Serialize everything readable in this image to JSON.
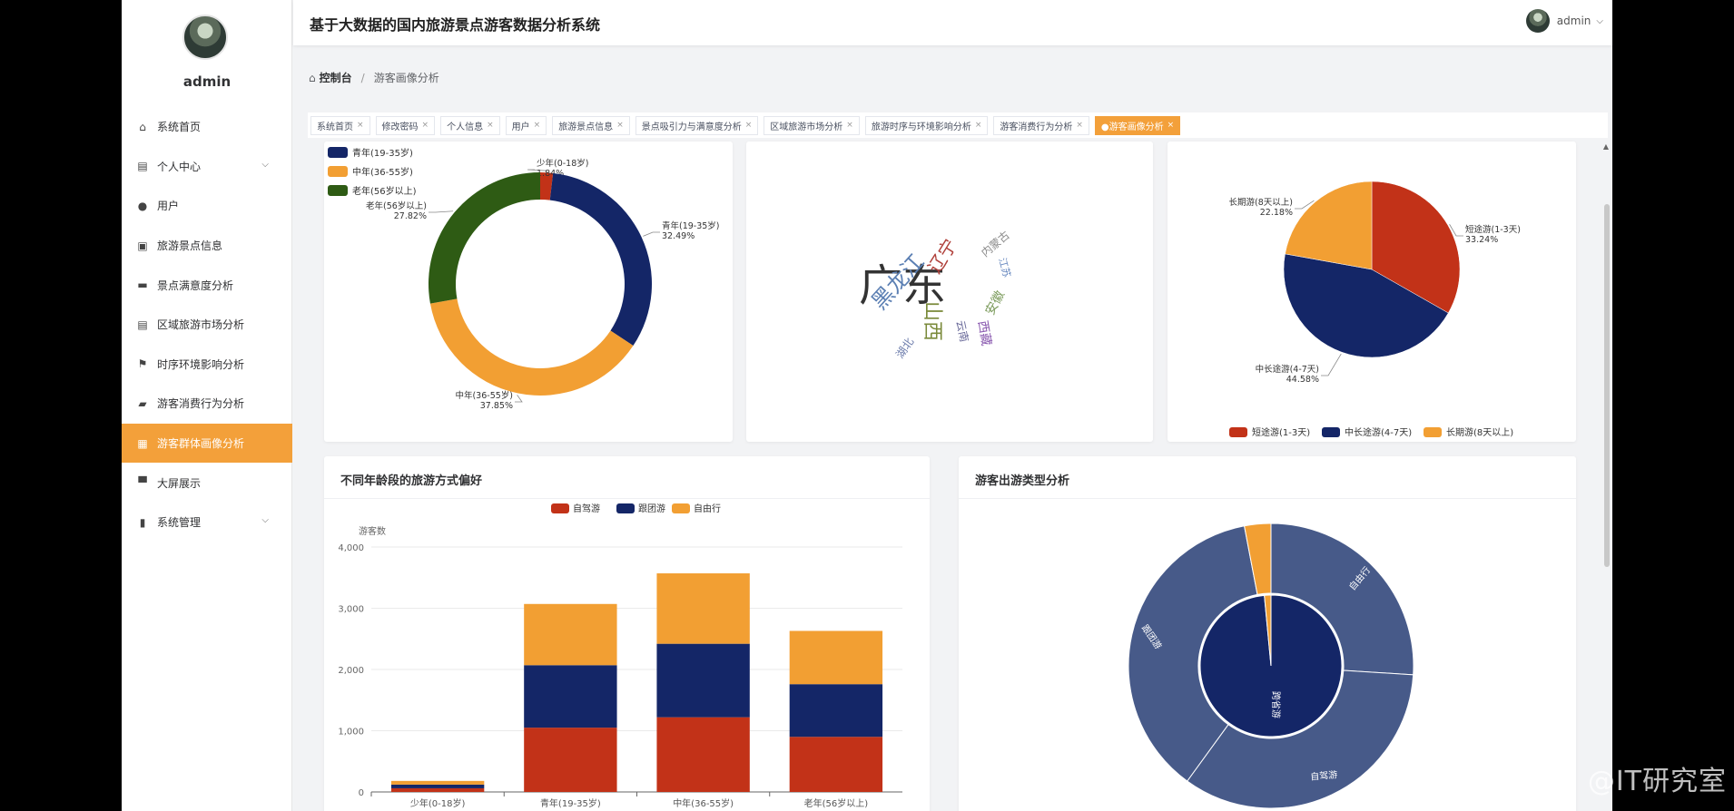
{
  "app": {
    "title": "基于大数据的国内旅游景点游客数据分析系统",
    "user": "admin"
  },
  "sidebar": {
    "username": "admin",
    "items": [
      {
        "label": "系统首页",
        "icon": "home-icon",
        "glyph": "⌂",
        "chevron": false,
        "active": false
      },
      {
        "label": "个人中心",
        "icon": "id-card-icon",
        "glyph": "▤",
        "chevron": true,
        "active": false
      },
      {
        "label": "用户",
        "icon": "location-pin-icon",
        "glyph": "●",
        "chevron": false,
        "active": false
      },
      {
        "label": "旅游景点信息",
        "icon": "clipboard-x-icon",
        "glyph": "▣",
        "chevron": false,
        "active": false
      },
      {
        "label": "景点满意度分析",
        "icon": "briefcase-icon",
        "glyph": "▬",
        "chevron": false,
        "active": false
      },
      {
        "label": "区域旅游市场分析",
        "icon": "clipboard-icon",
        "glyph": "▤",
        "chevron": false,
        "active": false
      },
      {
        "label": "时序环境影响分析",
        "icon": "flag-icon",
        "glyph": "⚑",
        "chevron": false,
        "active": false
      },
      {
        "label": "游客消费行为分析",
        "icon": "ticket-icon",
        "glyph": "▰",
        "chevron": false,
        "active": false
      },
      {
        "label": "游客群体画像分析",
        "icon": "grid-icon",
        "glyph": "▦",
        "chevron": false,
        "active": true
      },
      {
        "label": "大屏展示",
        "icon": "monitor-icon",
        "glyph": "▀",
        "chevron": false,
        "active": false
      },
      {
        "label": "系统管理",
        "icon": "bar-chart-icon",
        "glyph": "▮",
        "chevron": true,
        "active": false
      }
    ]
  },
  "breadcrumb": {
    "home": "控制台",
    "current": "游客画像分析"
  },
  "tags": [
    {
      "label": "系统首页",
      "active": false
    },
    {
      "label": "修改密码",
      "active": false
    },
    {
      "label": "个人信息",
      "active": false
    },
    {
      "label": "用户",
      "active": false
    },
    {
      "label": "旅游景点信息",
      "active": false
    },
    {
      "label": "景点吸引力与满意度分析",
      "active": false
    },
    {
      "label": "区域旅游市场分析",
      "active": false
    },
    {
      "label": "旅游时序与环境影响分析",
      "active": false
    },
    {
      "label": "游客消费行为分析",
      "active": false
    },
    {
      "label": "●游客画像分析",
      "active": true
    }
  ],
  "colors": {
    "accent": "#f3a03a",
    "red": "#c23218",
    "navy": "#142667",
    "orange": "#f29f33",
    "green": "#2e5b14",
    "slate": "#475a89"
  },
  "chart_data": [
    {
      "type": "pie",
      "variant": "donut",
      "slices": [
        {
          "name": "少年(0-18岁)",
          "value": 1.84,
          "label": "1.84%",
          "color": "#c23218"
        },
        {
          "name": "青年(19-35岁)",
          "value": 32.49,
          "label": "32.49%",
          "color": "#142667"
        },
        {
          "name": "中年(36-55岁)",
          "value": 37.85,
          "label": "37.85%",
          "color": "#f29f33"
        },
        {
          "name": "老年(56岁以上)",
          "value": 27.82,
          "label": "27.82%",
          "color": "#2e5b14"
        }
      ],
      "legend": [
        "青年(19-35岁)",
        "中年(36-55岁)",
        "老年(56岁以上)"
      ],
      "legend_position": "top-left"
    },
    {
      "type": "wordcloud",
      "words": [
        {
          "text": "广东",
          "color": "#333333"
        },
        {
          "text": "黑龙江",
          "color": "#5b7fb3"
        },
        {
          "text": "辽宁",
          "color": "#b0403a"
        },
        {
          "text": "内蒙古",
          "color": "#8a8a8a"
        },
        {
          "text": "山西",
          "color": "#7a8a3a"
        },
        {
          "text": "江苏",
          "color": "#6a8ac0"
        },
        {
          "text": "安徽",
          "color": "#7a9a5a"
        },
        {
          "text": "云南",
          "color": "#6a6a9a"
        },
        {
          "text": "湖北",
          "color": "#6a7aaa"
        },
        {
          "text": "西藏",
          "color": "#8a5ab0"
        }
      ]
    },
    {
      "type": "pie",
      "slices": [
        {
          "name": "短途游(1-3天)",
          "value": 33.24,
          "label": "33.24%",
          "color": "#c23218"
        },
        {
          "name": "中长途游(4-7天)",
          "value": 44.58,
          "label": "44.58%",
          "color": "#142667"
        },
        {
          "name": "长期游(8天以上)",
          "value": 22.18,
          "label": "22.18%",
          "color": "#f29f33"
        }
      ],
      "legend": [
        "短途游(1-3天)",
        "中长途游(4-7天)",
        "长期游(8天以上)"
      ],
      "legend_position": "bottom"
    },
    {
      "type": "bar",
      "stacked": true,
      "title": "不同年龄段的旅游方式偏好",
      "ylabel": "游客数",
      "categories": [
        "少年(0-18岁)",
        "青年(19-35岁)",
        "中年(36-55岁)",
        "老年(56岁以上)"
      ],
      "series": [
        {
          "name": "自驾游",
          "values": [
            60,
            1050,
            1220,
            900
          ],
          "color": "#c23218"
        },
        {
          "name": "跟团游",
          "values": [
            60,
            1020,
            1200,
            860
          ],
          "color": "#142667"
        },
        {
          "name": "自由行",
          "values": [
            60,
            1000,
            1150,
            870
          ],
          "color": "#f29f33"
        }
      ],
      "ylim": [
        0,
        4000
      ],
      "yticks": [
        "0",
        "1,000",
        "2,000",
        "3,000",
        "4,000"
      ],
      "legend_position": "top"
    },
    {
      "type": "pie",
      "variant": "nested",
      "title": "游客出游类型分析",
      "inner": [
        {
          "name": "跨省游",
          "value": 98.5,
          "color": "#142667"
        },
        {
          "name": "",
          "value": 1.5,
          "color": "#f29f33"
        }
      ],
      "outer": [
        {
          "name": "自由行",
          "value": 26,
          "color": "#475a89"
        },
        {
          "name": "自驾游",
          "value": 34,
          "color": "#475a89"
        },
        {
          "name": "跟团游",
          "value": 37,
          "color": "#475a89"
        },
        {
          "name": "",
          "value": 3,
          "color": "#f29f33"
        }
      ]
    }
  ],
  "watermark": "CSDN @IT研究室"
}
